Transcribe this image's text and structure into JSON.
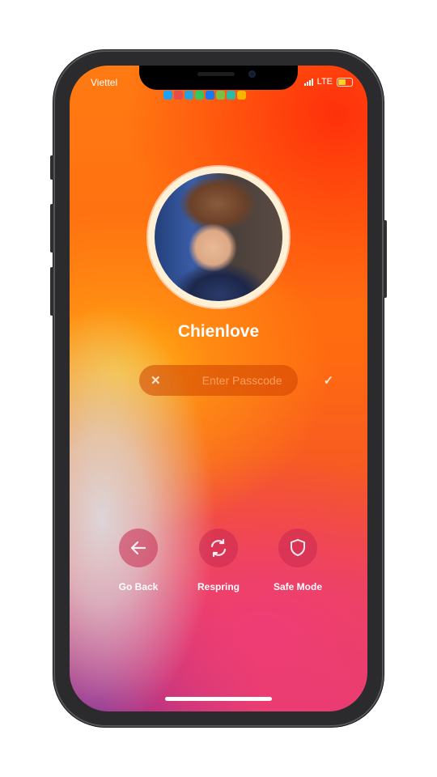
{
  "status_bar": {
    "carrier": "Viettel",
    "network": "LTE",
    "battery_level": 0.55,
    "notification_icons": [
      "twitter-icon",
      "mail-icon",
      "telegram-icon",
      "messages-icon",
      "facebook-icon",
      "wechat-icon",
      "maps-icon",
      "photos-icon"
    ]
  },
  "profile": {
    "name": "Chienlove"
  },
  "passcode": {
    "placeholder": "Enter Passcode",
    "value": ""
  },
  "actions": [
    {
      "label": "Go Back",
      "icon": "arrow-left-icon"
    },
    {
      "label": "Respring",
      "icon": "refresh-icon"
    },
    {
      "label": "Safe Mode",
      "icon": "shield-icon"
    }
  ],
  "colors": {
    "accent": "#ff6a10",
    "pill": "#cd4100",
    "action_circle": "#c82850"
  }
}
